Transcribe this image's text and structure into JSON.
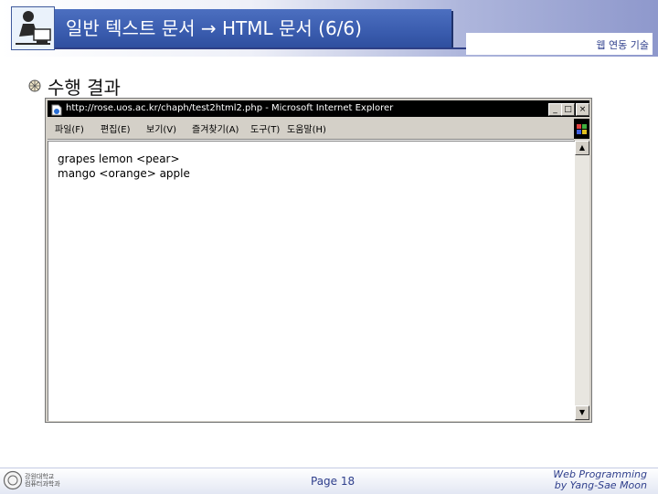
{
  "slide": {
    "title": "일반 텍스트 문서 → HTML 문서 (6/6)",
    "subject": "웹 연동 기술",
    "section_heading": "수행 결과",
    "page_label": "Page 18",
    "course_line1": "Web Programming",
    "course_line2": "by Yang-Sae Moon",
    "logo_line1": "강원대학교",
    "logo_line2": "컴퓨터과학과"
  },
  "browser": {
    "window_title": "http://rose.uos.ac.kr/chaph/test2html2.php - Microsoft Internet Explorer",
    "buttons": {
      "minimize": "_",
      "maximize": "□",
      "close": "×"
    },
    "menu": [
      "파일(F)",
      "편집(E)",
      "보기(V)",
      "즐겨찾기(A)",
      "도구(T)",
      "도움말(H)"
    ],
    "content_lines": [
      "grapes lemon <pear>",
      "mango <orange> apple"
    ],
    "scroll_up": "▲",
    "scroll_down": "▼"
  },
  "colors": {
    "title_bar": "#3a5cae",
    "accent_text": "#2f3f8c",
    "window_chrome": "#d4d0c8"
  },
  "icons": {
    "header": "person-at-computer-icon",
    "bullet": "shell-bullet-icon",
    "browser": "ie-page-icon",
    "throbber": "windows-logo-icon",
    "footer": "university-seal-icon"
  }
}
